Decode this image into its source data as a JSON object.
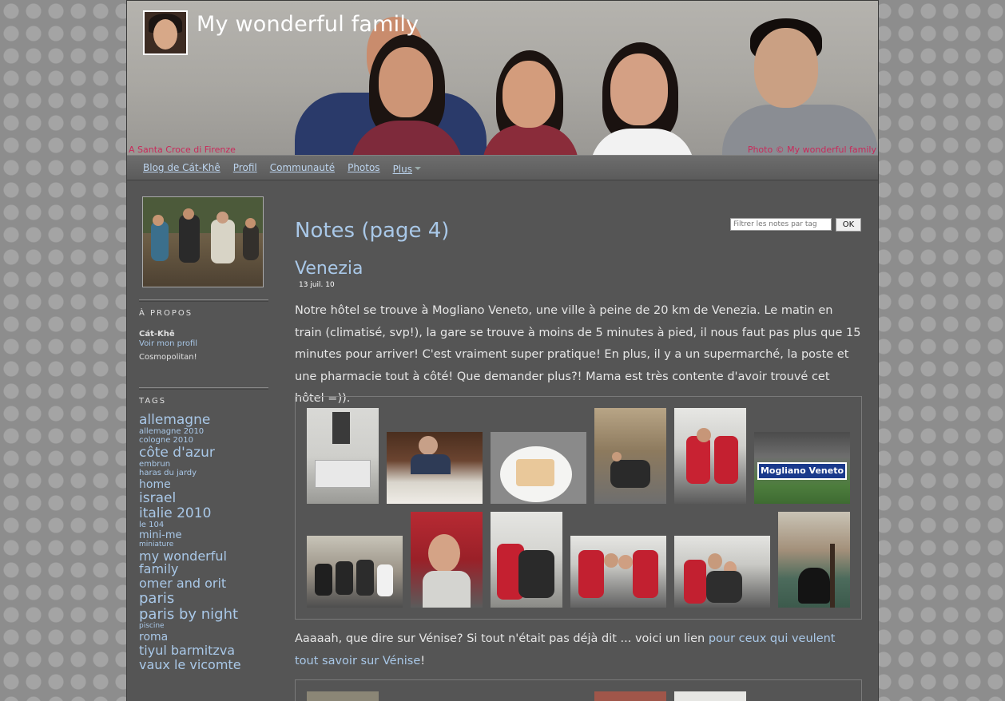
{
  "site": {
    "title": "My wonderful family",
    "caption_left": "A Santa Croce di Firenze",
    "caption_right": "Photo © My wonderful family"
  },
  "nav": {
    "items": [
      "Blog de Cát-Khê",
      "Profil",
      "Communauté",
      "Photos",
      "Plus"
    ]
  },
  "sidebar": {
    "about_heading": "À PROPOS",
    "about_name": "Cát-Khê",
    "about_link": "Voir mon profil",
    "about_desc": "Cosmopolitan!",
    "tags_heading": "TAGS",
    "tags": [
      {
        "label": "allemagne",
        "size": 17
      },
      {
        "label": "allemagne 2010",
        "size": 10
      },
      {
        "label": "cologne 2010",
        "size": 10
      },
      {
        "label": "côte d'azur",
        "size": 17
      },
      {
        "label": "embrun",
        "size": 10
      },
      {
        "label": "haras du jardy",
        "size": 10
      },
      {
        "label": "home",
        "size": 14
      },
      {
        "label": "israel",
        "size": 17
      },
      {
        "label": "italie 2010",
        "size": 17
      },
      {
        "label": "le 104",
        "size": 10
      },
      {
        "label": "mini-me",
        "size": 13
      },
      {
        "label": "miniature",
        "size": 9
      },
      {
        "label": "my wonderful family",
        "size": 16
      },
      {
        "label": "omer and orit",
        "size": 16
      },
      {
        "label": "paris",
        "size": 18
      },
      {
        "label": "paris by night",
        "size": 18
      },
      {
        "label": "piscine",
        "size": 9
      },
      {
        "label": "roma",
        "size": 14
      },
      {
        "label": "tiyul barmitzva",
        "size": 16
      },
      {
        "label": "vaux le vicomte",
        "size": 16
      }
    ]
  },
  "main": {
    "page_title": "Notes (page 4)",
    "filter_placeholder": "Filtrer les notes par tag",
    "filter_button": "OK",
    "post_title": "Venezia",
    "post_date": "13 juil. 10",
    "post_body": "Notre hôtel se trouve à Mogliano Veneto, une ville à peine de 20 km de Venezia. Le matin en train (climatisé, svp!), la gare se trouve à moins de 5 minutes à pied, il nous faut pas plus que 15 minutes pour arriver! C'est vraiment super pratique! En plus, il y a un supermarché, la poste et une pharmacie tout à côté! Que demander plus?! Mama est très contente d'avoir trouvé cet hôtel =)).",
    "post_body2_prefix": "Aaaaah, que dire sur Vénise? Si tout n'était pas déjà dit ... voici un lien ",
    "post_body2_link": "pour ceux qui veulent tout savoir sur Vénise",
    "post_body2_suffix": "!",
    "sign_text": "Mogliano Veneto"
  },
  "colors": {
    "page_bg": "#555555",
    "link": "#a9c8e8",
    "caption": "#c9295a"
  }
}
